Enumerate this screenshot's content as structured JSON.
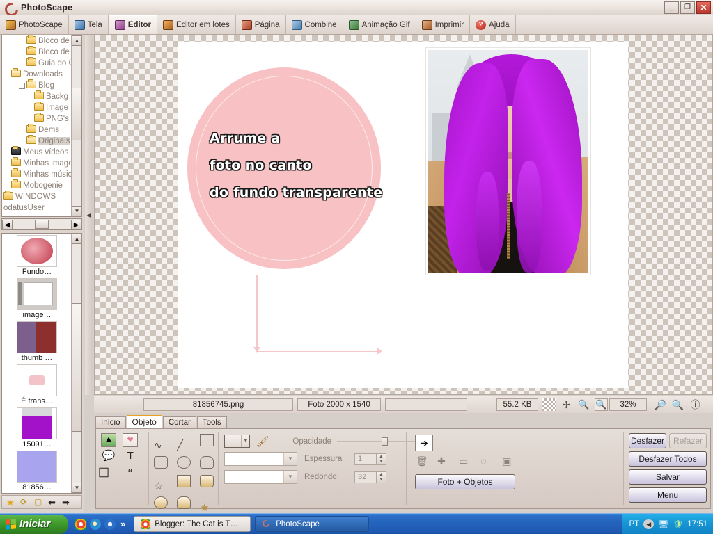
{
  "window": {
    "title": "PhotoScape",
    "app_icon": "photoscape-logo-icon",
    "minimize_label": "_",
    "maximize_label": "❐",
    "close_label": "✕"
  },
  "main_tabs": [
    {
      "label": "PhotoScape",
      "icon": "photoscape-icon",
      "active": false
    },
    {
      "label": "Tela",
      "icon": "viewer-icon",
      "active": false
    },
    {
      "label": "Editor",
      "icon": "editor-icon",
      "active": true
    },
    {
      "label": "Editor em lotes",
      "icon": "batch-editor-icon",
      "active": false
    },
    {
      "label": "Página",
      "icon": "page-icon",
      "active": false
    },
    {
      "label": "Combine",
      "icon": "combine-icon",
      "active": false
    },
    {
      "label": "Animação Gif",
      "icon": "gif-animation-icon",
      "active": false
    },
    {
      "label": "Imprimir",
      "icon": "print-icon",
      "active": false
    },
    {
      "label": "Ajuda",
      "icon": "help-icon",
      "active": false
    }
  ],
  "folder_tree": {
    "nodes": [
      {
        "label": "Bloco de",
        "indent": 3,
        "expander": "",
        "icon": "folder-icon",
        "selected": false
      },
      {
        "label": "Bloco de",
        "indent": 3,
        "expander": "",
        "icon": "folder-icon",
        "selected": false
      },
      {
        "label": "Guia do C",
        "indent": 3,
        "expander": "",
        "icon": "folder-icon",
        "selected": false
      },
      {
        "label": "Downloads",
        "indent": 1,
        "expander": "",
        "icon": "folder-open-icon",
        "selected": false
      },
      {
        "label": "Blog",
        "indent": 2,
        "expander": "-",
        "icon": "folder-open-icon",
        "selected": false
      },
      {
        "label": "Backg",
        "indent": 4,
        "expander": "",
        "icon": "folder-icon",
        "selected": false
      },
      {
        "label": "Image",
        "indent": 4,
        "expander": "",
        "icon": "folder-icon",
        "selected": false
      },
      {
        "label": "PNG's",
        "indent": 4,
        "expander": "",
        "icon": "folder-icon",
        "selected": false
      },
      {
        "label": "Dems",
        "indent": 3,
        "expander": "",
        "icon": "folder-icon",
        "selected": false
      },
      {
        "label": "Originals",
        "indent": 3,
        "expander": "",
        "icon": "folder-open-icon",
        "selected": true
      },
      {
        "label": "Meus vídeos",
        "indent": 1,
        "expander": "",
        "icon": "videos-folder-icon",
        "selected": false
      },
      {
        "label": "Minhas image",
        "indent": 1,
        "expander": "",
        "icon": "pictures-folder-icon",
        "selected": false
      },
      {
        "label": "Minhas músic",
        "indent": 1,
        "expander": "",
        "icon": "music-folder-icon",
        "selected": false
      },
      {
        "label": "Mobogenie",
        "indent": 1,
        "expander": "",
        "icon": "folder-icon",
        "selected": false
      },
      {
        "label": "WINDOWS",
        "indent": 0,
        "expander": "",
        "icon": "folder-icon",
        "selected": false
      },
      {
        "label": "odatusUser",
        "indent": 0,
        "expander": "",
        "icon": "",
        "selected": false
      }
    ],
    "scroll_up": "▲",
    "scroll_down": "▼",
    "scroll_left": "◀",
    "scroll_right": "▶"
  },
  "thumbnails": {
    "items": [
      {
        "label": "Fundo…",
        "kind": "pink-round-thumb"
      },
      {
        "label": "image…",
        "kind": "screenshot-thumb"
      },
      {
        "label": "thumb …",
        "kind": "two-people-thumb"
      },
      {
        "label": "É trans…",
        "kind": "small-pink-thumb"
      },
      {
        "label": "15091…",
        "kind": "purple-hair-thumb"
      },
      {
        "label": "81856…",
        "kind": "solid-lavender-thumb"
      }
    ],
    "toolbar_icons": [
      "favorite-star-icon",
      "rotate-icon",
      "slideshow-icon",
      "previous-arrow-icon",
      "next-arrow-icon"
    ]
  },
  "canvas": {
    "circle_caption_lines": [
      "Arrume a",
      "foto no canto",
      "do fundo transparente"
    ],
    "circle_color": "#f8c2c4",
    "arrow_color": "#f6c7c9",
    "photo_alt": "purple-haired-woman-photo"
  },
  "statusbar": {
    "filename": "81856745.png",
    "dimensions": "Foto 2000 x 1540",
    "filesize": "55.2 KB",
    "zoom": "32%",
    "icons": [
      "transparency-icon",
      "fit-screen-icon",
      "actual-size-icon",
      "fit-window-icon",
      "zoom-in-icon",
      "zoom-out-icon",
      "info-icon"
    ]
  },
  "editor": {
    "tabs": [
      {
        "label": "Início",
        "active": false
      },
      {
        "label": "Objeto",
        "active": true
      },
      {
        "label": "Cortar",
        "active": false
      },
      {
        "label": "Tools",
        "active": false
      }
    ],
    "insert_tools": [
      "insert-image-icon",
      "insert-clipart-icon",
      "insert-balloon-icon",
      "insert-text-icon",
      "insert-vertical-text-icon",
      "insert-quote-icon"
    ],
    "shape_tools": [
      "freehand-icon",
      "line-icon",
      "rectangle-icon",
      "rounded-rect-icon",
      "ellipse-icon",
      "pentagon-icon",
      "star-outline-icon",
      "filled-rect-icon",
      "filled-rounded-rect-icon",
      "filled-ellipse-icon",
      "filled-pentagon-icon",
      "filled-star-icon"
    ],
    "color_swatch_label": "",
    "eyedropper_icon": "eyedropper-icon",
    "combo_line": "",
    "combo_fill": "",
    "opacity_label": "Opacidade",
    "thickness_label": "Espessura",
    "thickness_value": "1",
    "roundness_label": "Redondo",
    "roundness_value": "32",
    "select_tool_icon": "pointer-arrow-icon",
    "object_ops": [
      "delete-object-icon",
      "duplicate-object-icon",
      "bring-front-icon",
      "merge-icon",
      "rasterize-icon"
    ],
    "flatten_button": "Foto + Objetos",
    "right_buttons": [
      {
        "label": "Desfazer",
        "disabled": false
      },
      {
        "label": "Refazer",
        "disabled": true
      },
      {
        "label": "Desfazer Todos",
        "disabled": false
      },
      {
        "label": "Salvar",
        "disabled": false
      },
      {
        "label": "Menu",
        "disabled": false
      }
    ]
  },
  "taskbar": {
    "start_label": "Iniciar",
    "quicklaunch": [
      "chrome-icon",
      "internet-explorer-icon",
      "windows-media-icon"
    ],
    "quicklaunch_overflow": "»",
    "buttons": [
      {
        "label": "Blogger: The Cat is T…",
        "icon": "chrome-icon",
        "active": false
      },
      {
        "label": "PhotoScape",
        "icon": "photoscape-icon",
        "active": true
      }
    ],
    "language": "PT",
    "tray_icons": [
      "show-hidden-icon",
      "network-icon",
      "antivirus-icon"
    ],
    "clock": "17:51"
  },
  "colors": {
    "accent_pink": "#f8c2c4",
    "hair_purple": "#b418da",
    "tab_active_underline": "#e8a020",
    "taskbar_blue": "#2463bd",
    "start_green": "#3f9b2c"
  }
}
